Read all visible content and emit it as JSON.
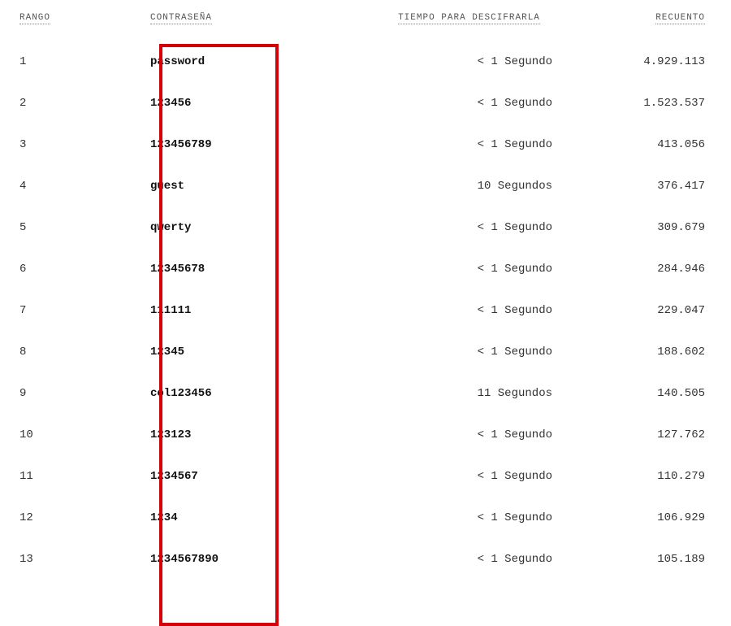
{
  "chart_data": {
    "type": "table",
    "columns": [
      "RANGO",
      "CONTRASEÑA",
      "TIEMPO PARA DESCIFRARLA",
      "RECUENTO"
    ],
    "rows": [
      {
        "rank": "1",
        "password": "password",
        "time": "< 1 Segundo",
        "count": "4.929.113"
      },
      {
        "rank": "2",
        "password": "123456",
        "time": "< 1 Segundo",
        "count": "1.523.537"
      },
      {
        "rank": "3",
        "password": "123456789",
        "time": "< 1 Segundo",
        "count": "413.056"
      },
      {
        "rank": "4",
        "password": "guest",
        "time": "10 Segundos",
        "count": "376.417"
      },
      {
        "rank": "5",
        "password": "qwerty",
        "time": "< 1 Segundo",
        "count": "309.679"
      },
      {
        "rank": "6",
        "password": "12345678",
        "time": "< 1 Segundo",
        "count": "284.946"
      },
      {
        "rank": "7",
        "password": "111111",
        "time": "< 1 Segundo",
        "count": "229.047"
      },
      {
        "rank": "8",
        "password": "12345",
        "time": "< 1 Segundo",
        "count": "188.602"
      },
      {
        "rank": "9",
        "password": "col123456",
        "time": "11 Segundos",
        "count": "140.505"
      },
      {
        "rank": "10",
        "password": "123123",
        "time": "< 1 Segundo",
        "count": "127.762"
      },
      {
        "rank": "11",
        "password": "1234567",
        "time": "< 1 Segundo",
        "count": "110.279"
      },
      {
        "rank": "12",
        "password": "1234",
        "time": "< 1 Segundo",
        "count": "106.929"
      },
      {
        "rank": "13",
        "password": "1234567890",
        "time": "< 1 Segundo",
        "count": "105.189"
      }
    ]
  },
  "headers": {
    "rank": "RANGO",
    "password": "CONTRASEÑA",
    "time": "TIEMPO PARA DESCIFRARLA",
    "count": "RECUENTO"
  },
  "highlight": {
    "column": "password",
    "color": "#d4000a"
  }
}
